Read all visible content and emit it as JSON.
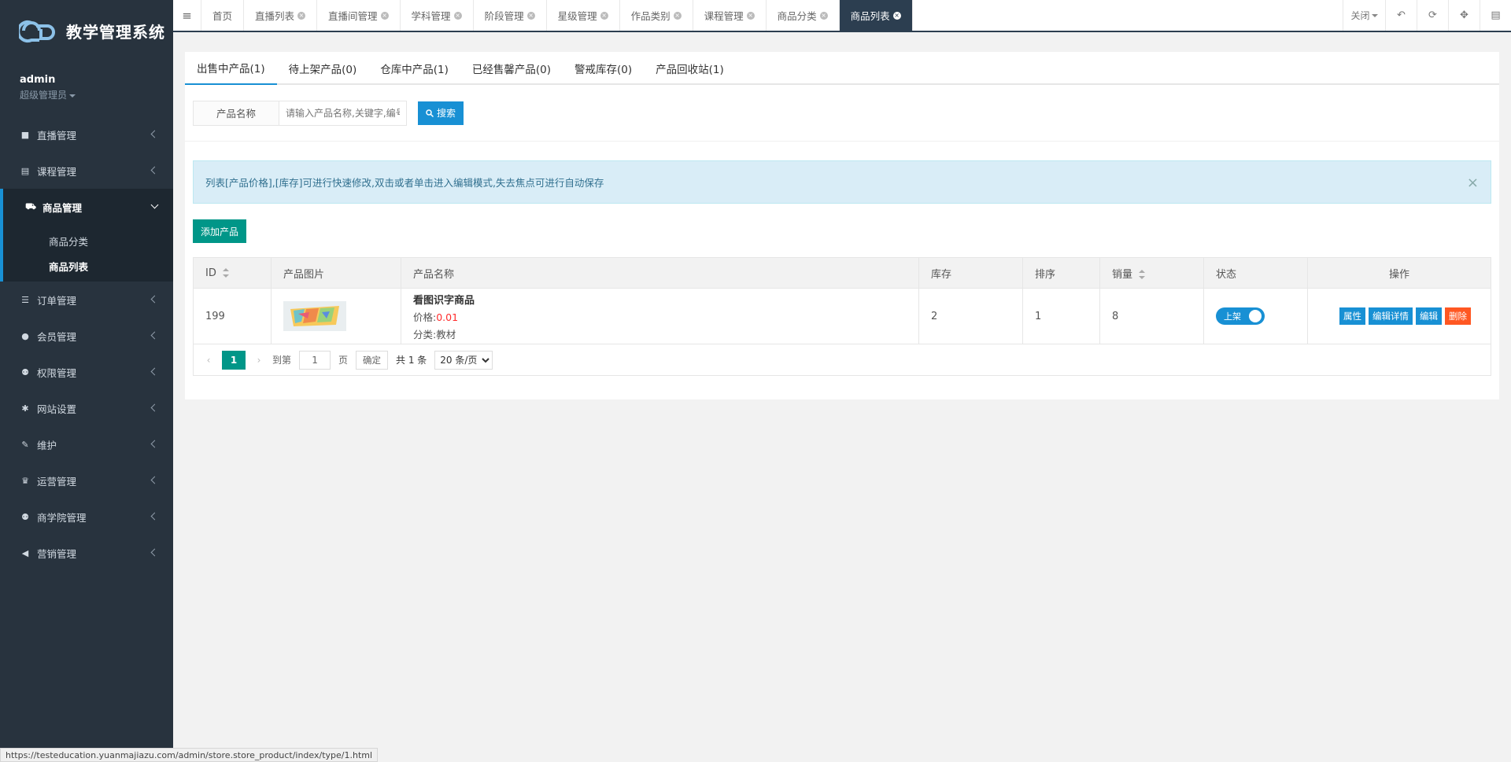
{
  "app": {
    "title": "教学管理系统"
  },
  "user": {
    "name": "admin",
    "role": "超级管理员"
  },
  "sidebar": {
    "items": [
      {
        "label": "直播管理",
        "icon": "video-icon"
      },
      {
        "label": "课程管理",
        "icon": "book-icon"
      },
      {
        "label": "商品管理",
        "icon": "cart-icon",
        "open": true,
        "children": [
          {
            "label": "商品分类"
          },
          {
            "label": "商品列表",
            "active": true
          }
        ]
      },
      {
        "label": "订单管理",
        "icon": "list-icon"
      },
      {
        "label": "会员管理",
        "icon": "user-icon"
      },
      {
        "label": "权限管理",
        "icon": "group-icon"
      },
      {
        "label": "网站设置",
        "icon": "gear-icon"
      },
      {
        "label": "维护",
        "icon": "wrench-icon"
      },
      {
        "label": "运营管理",
        "icon": "trophy-icon"
      },
      {
        "label": "商学院管理",
        "icon": "group-icon"
      },
      {
        "label": "营销管理",
        "icon": "megaphone-icon"
      }
    ]
  },
  "topbar": {
    "tabs": [
      {
        "label": "首页",
        "closable": false
      },
      {
        "label": "直播列表",
        "closable": true
      },
      {
        "label": "直播间管理",
        "closable": true
      },
      {
        "label": "学科管理",
        "closable": true
      },
      {
        "label": "阶段管理",
        "closable": true
      },
      {
        "label": "星级管理",
        "closable": true
      },
      {
        "label": "作品类别",
        "closable": true
      },
      {
        "label": "课程管理",
        "closable": true
      },
      {
        "label": "商品分类",
        "closable": true
      },
      {
        "label": "商品列表",
        "closable": true,
        "active": true
      }
    ],
    "close_label": "关闭"
  },
  "product_tabs": [
    {
      "label": "出售中产品(1)",
      "active": true
    },
    {
      "label": "待上架产品(0)"
    },
    {
      "label": "仓库中产品(1)"
    },
    {
      "label": "已经售馨产品(0)"
    },
    {
      "label": "警戒库存(0)"
    },
    {
      "label": "产品回收站(1)"
    }
  ],
  "search": {
    "label": "产品名称",
    "placeholder": "请输入产品名称,关键字,编号",
    "button": "搜索"
  },
  "alert": {
    "text": "列表[产品价格],[库存]可进行快速修改,双击或者单击进入编辑模式,失去焦点可进行自动保存",
    "close": "×"
  },
  "add_button": "添加产品",
  "table": {
    "headers": {
      "id": "ID",
      "image": "产品图片",
      "name": "产品名称",
      "stock": "库存",
      "sort": "排序",
      "sales": "销量",
      "status": "状态",
      "ops": "操作"
    },
    "rows": [
      {
        "id": "199",
        "name": "看图识字商品",
        "price_label": "价格:",
        "price": "0.01",
        "category_label": "分类:",
        "category": "教材",
        "stock": "2",
        "sort": "1",
        "sales": "8",
        "status": "上架",
        "ops": [
          "属性",
          "编辑详情",
          "编辑",
          "删除"
        ]
      }
    ]
  },
  "pager": {
    "current": "1",
    "goto_label": "到第",
    "goto_value": "1",
    "page_unit": "页",
    "confirm": "确定",
    "total": "共 1 条",
    "page_size": "20 条/页"
  },
  "status_url": "https://testeducation.yuanmajiazu.com/admin/store.store_product/index/type/1.html",
  "colors": {
    "sidebar_bg": "#28333e",
    "accent": "#1890d4",
    "green": "#009688",
    "danger": "#ff5722",
    "price": "#ff2b2b"
  }
}
